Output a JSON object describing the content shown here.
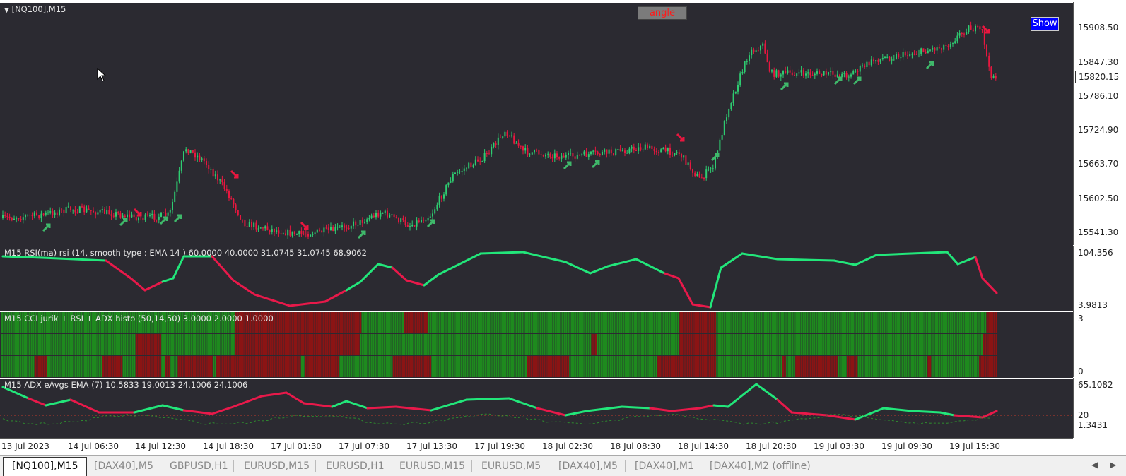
{
  "main_chart": {
    "title": "[NQ100],M15",
    "angle_button": "angle",
    "show_button": "Show",
    "price_ticks": [
      "15908.50",
      "15847.30",
      "15786.10",
      "15724.90",
      "15663.70",
      "15602.50",
      "15541.30"
    ],
    "current_price": "15820.15"
  },
  "rsi_panel": {
    "title": "M15 RSI(ma) rsi (14, smooth type : EMA  14 ) 60.0000 40.0000 31.0745 31.0745 68.9062",
    "scale_top": "104.356",
    "scale_bottom": "3.9813"
  },
  "cci_panel": {
    "title": "M15  CCI jurik + RSI + ADX histo (50,14,50) 3.0000 2.0000 1.0000",
    "scale_top": "3",
    "scale_bottom": "0"
  },
  "adx_panel": {
    "title": "M15  ADX eAvgs EMA (7) 10.5833 19.0013 24.1006 24.1006",
    "scale_top": "65.1082",
    "scale_mid": "20",
    "scale_bottom": "1.3431"
  },
  "time_axis": [
    "13 Jul 2023",
    "14 Jul 06:30",
    "14 Jul 12:30",
    "14 Jul 18:30",
    "17 Jul 01:30",
    "17 Jul 07:30",
    "17 Jul 13:30",
    "17 Jul 19:30",
    "18 Jul 02:30",
    "18 Jul 08:30",
    "18 Jul 14:30",
    "18 Jul 20:30",
    "19 Jul 03:30",
    "19 Jul 09:30",
    "19 Jul 15:30"
  ],
  "tabs": [
    "[NQ100],M15",
    "[DAX40],M5",
    "GBPUSD,H1",
    "EURUSD,M15",
    "EURUSD,H1",
    "EURUSD,M15",
    "EURUSD,M5",
    "[DAX40],M5",
    "[DAX40],M1",
    "[DAX40],M2 (offline)"
  ],
  "colors": {
    "bull": "#2ecc71",
    "bear": "#e8173f",
    "background": "#2b2a31",
    "histo_green": "#1e8a1e",
    "histo_red": "#8b1414",
    "rsi_up": "#22e67a",
    "rsi_down": "#e8194a"
  }
}
